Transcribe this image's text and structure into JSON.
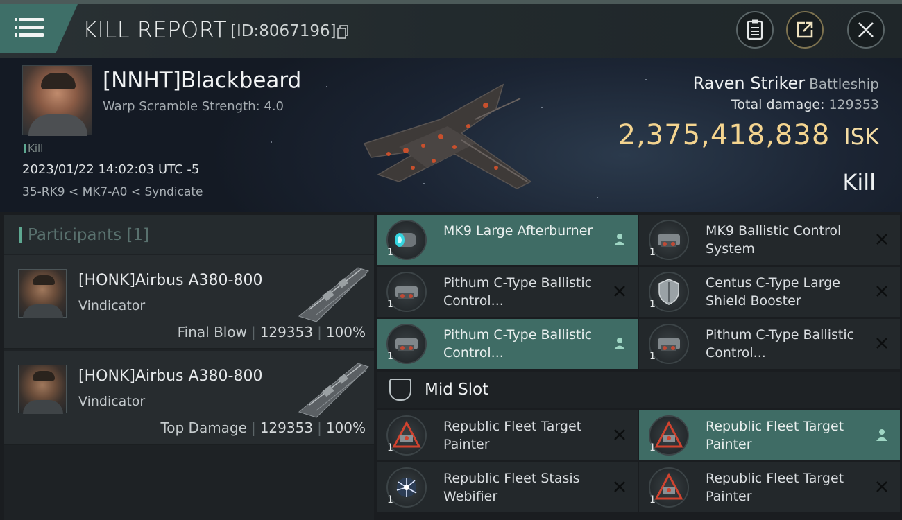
{
  "header": {
    "title": "KILL REPORT",
    "id_text": "[ID:8067196]",
    "menu_icon": "hamburger-menu-icon",
    "buttons": [
      "report-icon",
      "share-icon",
      "close-icon"
    ]
  },
  "victim": {
    "pilot": "[NNHT]Blackbeard",
    "warp_scramble": "Warp Scramble Strength: 4.0",
    "tag": "Kill",
    "datetime": "2023/01/22 14:02:03 UTC -5",
    "location": "35-RK9 < MK7-A0 < Syndicate",
    "ship": "Raven Striker",
    "ship_class": "Battleship",
    "total_damage_label": "Total damage:",
    "total_damage": "129353",
    "isk_value": "2,375,418,838",
    "isk_unit": "ISK",
    "result": "Kill"
  },
  "participants": {
    "title": "Participants",
    "count": "[1]",
    "rows": [
      {
        "name": "[HONK]Airbus A380-800",
        "ship": "Vindicator",
        "role": "Final Blow",
        "damage": "129353",
        "percent": "100%"
      },
      {
        "name": "[HONK]Airbus A380-800",
        "ship": "Vindicator",
        "role": "Top Damage",
        "damage": "129353",
        "percent": "100%"
      }
    ]
  },
  "modules": {
    "high": [
      {
        "name": "MK9 Large Afterburner",
        "qty": "1",
        "flag": "person",
        "highlight": true
      },
      {
        "name": "MK9 Ballistic Control System",
        "qty": "1",
        "flag": "x",
        "highlight": false
      },
      {
        "name": "Pithum C-Type Ballistic Control...",
        "qty": "1",
        "flag": "x",
        "highlight": false
      },
      {
        "name": "Centus C-Type Large Shield Booster",
        "qty": "1",
        "flag": "x",
        "highlight": false
      },
      {
        "name": "Pithum C-Type Ballistic Control...",
        "qty": "1",
        "flag": "person",
        "highlight": true
      },
      {
        "name": "Pithum C-Type Ballistic Control...",
        "qty": "1",
        "flag": "x",
        "highlight": false
      }
    ],
    "mid_slot_label": "Mid Slot",
    "mid": [
      {
        "name": "Republic Fleet Target Painter",
        "qty": "1",
        "flag": "x",
        "highlight": false
      },
      {
        "name": "Republic Fleet Target Painter",
        "qty": "1",
        "flag": "person",
        "highlight": true
      },
      {
        "name": "Republic Fleet Stasis Webifier",
        "qty": "1",
        "flag": "x",
        "highlight": false
      },
      {
        "name": "Republic Fleet Target Painter",
        "qty": "1",
        "flag": "x",
        "highlight": false
      }
    ]
  },
  "colors": {
    "accent": "#3f6c65",
    "isk_gold": "#f4d48f",
    "kill_mark": "#5ea891"
  }
}
